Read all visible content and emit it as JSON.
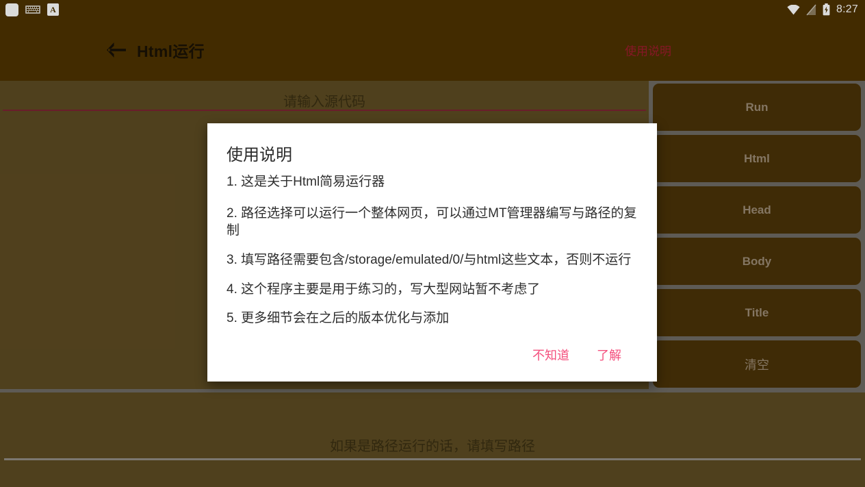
{
  "status_bar": {
    "icons_left": [
      "app-placeholder-icon",
      "keyboard-icon",
      "input-method-a-icon"
    ],
    "input_method_label": "A",
    "icons_right": [
      "wifi-icon",
      "sim-card-off-icon",
      "battery-charging-icon"
    ],
    "clock": "8:27"
  },
  "app_bar": {
    "back_icon": "arrow-left-icon",
    "title": "Html运行",
    "help_label": "使用说明"
  },
  "editor": {
    "source_placeholder": "请输入源代码",
    "source_value": "",
    "path_placeholder": "如果是路径运行的话，请填写路径",
    "path_value": ""
  },
  "side_buttons": [
    {
      "label": "Run",
      "cjk": false
    },
    {
      "label": "Html",
      "cjk": false
    },
    {
      "label": "Head",
      "cjk": false
    },
    {
      "label": "Body",
      "cjk": false
    },
    {
      "label": "Title",
      "cjk": false
    },
    {
      "label": "清空",
      "cjk": true
    }
  ],
  "dialog": {
    "title": "使用说明",
    "lines": [
      "1. 这是关于Html简易运行器",
      " 2. 路径选择可以运行一个整体网页，可以通过MT管理器编写与路径的复制",
      "3. 填写路径需要包含/storage/emulated/0/与html这些文本，否则不运行",
      "4. 这个程序主要是用于练习的，写大型网站暂不考虑了",
      "5. 更多细节会在之后的版本优化与添加"
    ],
    "negative_label": "不知道",
    "positive_label": "了解"
  },
  "colors": {
    "app_bar_bg": "#4d3300",
    "body_bg": "#5d4b22",
    "side_panel_bg": "#6e6a63",
    "side_button_bg": "#4a3308",
    "accent_help": "#9e1b2e",
    "accent_dialog_button": "#f4507e",
    "source_underline": "#7b2233"
  }
}
